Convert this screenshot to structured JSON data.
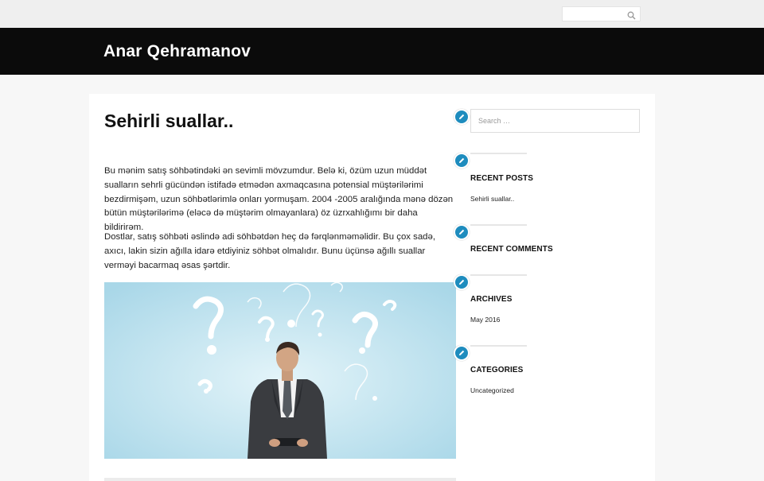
{
  "top_search": {
    "placeholder": ""
  },
  "site": {
    "title": "Anar Qehramanov"
  },
  "post": {
    "title": "Sehirli suallar..",
    "paragraph1": "Bu mənim satış söhbətindəki ən sevimli mövzumdur. Belə ki, özüm uzun müddət sualların sehrli gücündən istifadə etmədən axmaqcasına potensial müştərilərimi bezdirmişəm, uzun söhbətlərimlə onları yormuşam. 2004 -2005 aralığında mənə dözən bütün müştərilərimə (eləcə də müştərim olmayanlara) öz üzrxahlığımı bir daha bildirirəm.",
    "paragraph2": "Dostlar, satış söhbəti əslində adi söhbətdən heç də fərqlənməməlidir. Bu çox sadə, axıcı, lakin sizin ağılla idarə etdiyiniz söhbət olmalıdır. Bunu üçünsə ağıllı suallar verməyi bacarmaq əsas şərtdir."
  },
  "sidebar": {
    "search_placeholder": "Search …",
    "recent_posts": {
      "title": "RECENT POSTS",
      "items": [
        "Sehirli suallar.."
      ]
    },
    "recent_comments": {
      "title": "RECENT COMMENTS"
    },
    "archives": {
      "title": "ARCHIVES",
      "items": [
        "May 2016"
      ]
    },
    "categories": {
      "title": "CATEGORIES",
      "items": [
        "Uncategorized"
      ]
    }
  },
  "colors": {
    "header_bg": "#0b0b0b",
    "edit_button": "#1e8cbe",
    "image_bg": "#bfe3ef"
  },
  "icons": [
    "search-icon",
    "pencil-icon"
  ]
}
